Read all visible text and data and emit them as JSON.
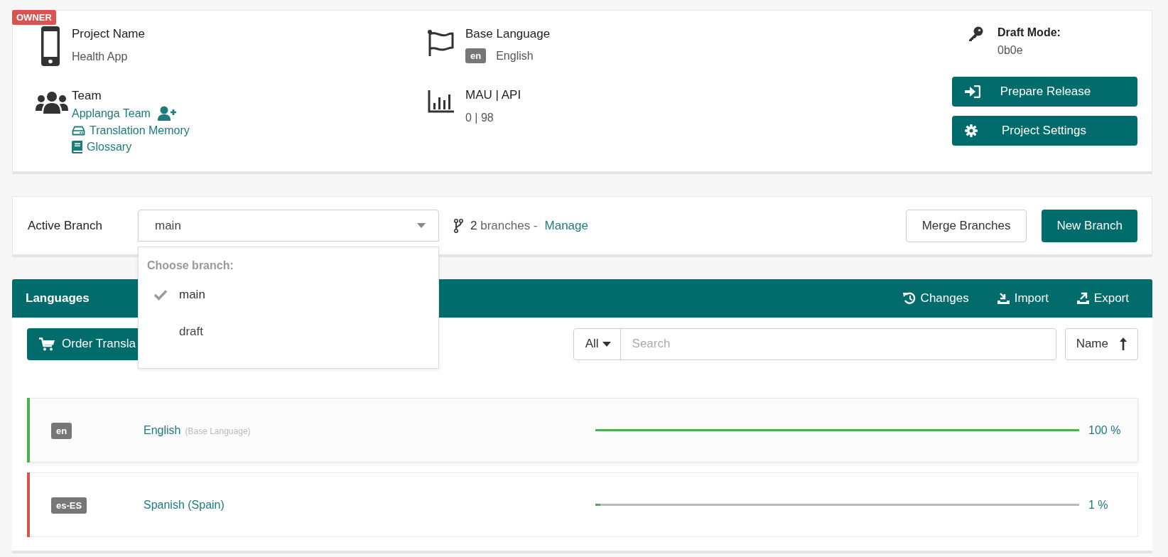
{
  "owner_badge": "OWNER",
  "project": {
    "name_label": "Project Name",
    "name": "Health App",
    "base_language_label": "Base Language",
    "base_language_code": "en",
    "base_language": "English",
    "team_label": "Team",
    "team_link": "Applanga Team",
    "links": [
      {
        "kind": "memory",
        "label": "Translation Memory"
      },
      {
        "kind": "glossary",
        "label": "Glossary"
      }
    ],
    "usage_label": "MAU | API",
    "usage": "0 | 98",
    "draft_mode_label": "Draft Mode:",
    "draft_mode_code": "0b0e",
    "buttons": [
      {
        "kind": "release",
        "label": "Prepare Release"
      },
      {
        "kind": "settings",
        "label": "Project Settings"
      }
    ]
  },
  "branch": {
    "label": "Active Branch",
    "selected": "main",
    "count": "2",
    "count_text": "branches -",
    "manage": "Manage",
    "merge_button": "Merge Branches",
    "new_button": "New Branch",
    "dropdown": {
      "expanded": true,
      "heading": "Choose branch:",
      "options": [
        {
          "label": "main",
          "selected": true
        },
        {
          "label": "draft",
          "selected": false
        }
      ]
    }
  },
  "languages": {
    "title": "Languages",
    "actions": [
      {
        "kind": "history",
        "label": "Changes"
      },
      {
        "kind": "import",
        "label": "Import"
      },
      {
        "kind": "export",
        "label": "Export"
      }
    ],
    "order_button": "Order Transla",
    "filter": "All",
    "search": {
      "placeholder": "Search"
    },
    "sort": "Name",
    "rows": [
      {
        "code": "en",
        "name": "English",
        "note": "(Base Language)",
        "level": 1.0,
        "percent": "100 %",
        "color": "#4caf50",
        "highlighted": true
      },
      {
        "code": "es-ES",
        "name": "Spanish (Spain)",
        "level": 0.01,
        "percent": "1 %",
        "color": "#d9534f",
        "highlighted": false
      }
    ]
  }
}
